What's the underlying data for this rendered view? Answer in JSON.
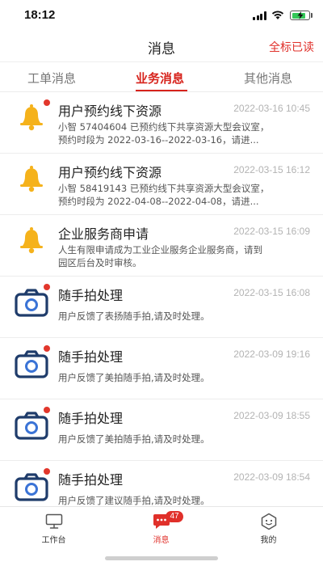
{
  "status_bar": {
    "time": "18:12"
  },
  "header": {
    "title": "消息",
    "mark_all_read": "全标已读"
  },
  "tabs": [
    {
      "label": "工单消息",
      "active": false
    },
    {
      "label": "业务消息",
      "active": true
    },
    {
      "label": "其他消息",
      "active": false
    }
  ],
  "messages": [
    {
      "icon": "bell-icon",
      "unread": true,
      "title": "用户预约线下资源",
      "time": "2022-03-16 10:45",
      "body": [
        "小智 57404604 已预约线下共享资源大型会议室，",
        "预约时段为 2022-03-16--2022-03-16，请进..."
      ]
    },
    {
      "icon": "bell-icon",
      "unread": false,
      "title": "用户预约线下资源",
      "time": "2022-03-15 16:12",
      "body": [
        "小智 58419143 已预约线下共享资源大型会议室，",
        "预约时段为 2022-04-08--2022-04-08，请进..."
      ]
    },
    {
      "icon": "bell-icon",
      "unread": false,
      "title": "企业服务商申请",
      "time": "2022-03-15 16:09",
      "body": [
        "人生有限申请成为工业企业服务企业服务商，请到",
        "园区后台及时审核。"
      ]
    },
    {
      "icon": "camera-icon",
      "unread": true,
      "title": "随手拍处理",
      "time": "2022-03-15 16:08",
      "body": [
        "用户反馈了表扬随手拍,请及时处理。"
      ]
    },
    {
      "icon": "camera-icon",
      "unread": true,
      "title": "随手拍处理",
      "time": "2022-03-09 19:16",
      "body": [
        "用户反馈了美拍随手拍,请及时处理。"
      ]
    },
    {
      "icon": "camera-icon",
      "unread": true,
      "title": "随手拍处理",
      "time": "2022-03-09 18:55",
      "body": [
        "用户反馈了美拍随手拍,请及时处理。"
      ]
    },
    {
      "icon": "camera-icon",
      "unread": true,
      "title": "随手拍处理",
      "time": "2022-03-09 18:54",
      "body": [
        "用户反馈了建议随手拍,请及时处理。"
      ]
    }
  ],
  "tab_bar": [
    {
      "label": "工作台",
      "icon": "monitor-icon",
      "active": false
    },
    {
      "label": "消息",
      "icon": "chat-bubble-icon",
      "active": true,
      "badge": "47"
    },
    {
      "label": "我的",
      "icon": "profile-face-icon",
      "active": false
    }
  ],
  "colors": {
    "accent": "#e0302a",
    "bell": "#f5b21b",
    "camera": "#1f3c6b",
    "camera_lens": "#3a73d6",
    "unread_dot": "#e2372c"
  }
}
